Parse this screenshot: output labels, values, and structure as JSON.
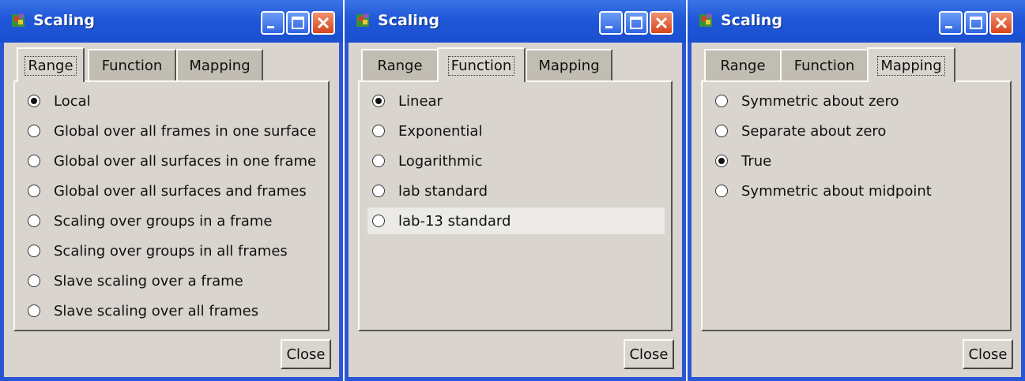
{
  "colors": {
    "title_blue": "#2a55d4",
    "client_gray": "#d9d5ce",
    "close_red": "#d6451d"
  },
  "windows": [
    {
      "title": "Scaling",
      "tabs": [
        "Range",
        "Function",
        "Mapping"
      ],
      "active_tab": "Range",
      "options": [
        "Local",
        "Global over all frames in one surface",
        "Global over all surfaces in one frame",
        "Global over all surfaces and frames",
        "Scaling over groups in a frame",
        "Scaling over groups in all frames",
        "Slave scaling over a frame",
        "Slave scaling over all frames"
      ],
      "selected": "Local",
      "close_label": "Close"
    },
    {
      "title": "Scaling",
      "tabs": [
        "Range",
        "Function",
        "Mapping"
      ],
      "active_tab": "Function",
      "options": [
        "Linear",
        "Exponential",
        "Logarithmic",
        "lab standard",
        "lab-13 standard"
      ],
      "selected": "Linear",
      "hovered": "lab-13 standard",
      "close_label": "Close"
    },
    {
      "title": "Scaling",
      "tabs": [
        "Range",
        "Function",
        "Mapping"
      ],
      "active_tab": "Mapping",
      "options": [
        "Symmetric about zero",
        "Separate about zero",
        "True",
        "Symmetric about midpoint"
      ],
      "selected": "True",
      "close_label": "Close"
    }
  ],
  "icons": {
    "app": "app-icon",
    "minimize": "minimize-icon",
    "maximize": "maximize-icon",
    "close": "close-icon"
  }
}
